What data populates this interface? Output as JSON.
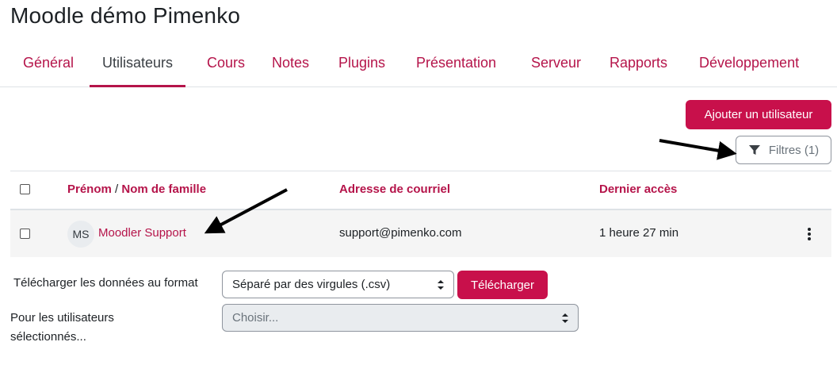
{
  "page": {
    "title": "Moodle démo Pimenko"
  },
  "tabs": [
    {
      "label": "Général",
      "active": false
    },
    {
      "label": "Utilisateurs",
      "active": true
    },
    {
      "label": "Cours",
      "active": false
    },
    {
      "label": "Notes",
      "active": false
    },
    {
      "label": "Plugins",
      "active": false
    },
    {
      "label": "Présentation",
      "active": false
    },
    {
      "label": "Serveur",
      "active": false
    },
    {
      "label": "Rapports",
      "active": false
    },
    {
      "label": "Développement",
      "active": false
    }
  ],
  "actions": {
    "add_user": "Ajouter un utilisateur",
    "filters": "Filtres (1)"
  },
  "table": {
    "columns": {
      "firstname": "Prénom",
      "separator": "/",
      "lastname": "Nom de famille",
      "email": "Adresse de courriel",
      "last_access": "Dernier accès"
    },
    "rows": [
      {
        "initials": "MS",
        "name": "Moodler Support",
        "email": "support@pimenko.com",
        "last_access": "1 heure 27 min"
      }
    ]
  },
  "download": {
    "label": "Télécharger les données au format",
    "format_selected": "Séparé par des virgules (.csv)",
    "button": "Télécharger"
  },
  "bulk": {
    "label": "Pour les utilisateurs sélectionnés...",
    "placeholder": "Choisir..."
  },
  "colors": {
    "accent": "#c8104b",
    "link": "#b5144a",
    "arrow": "#000000"
  },
  "icons": {
    "filter": "filter-icon",
    "row_menu": "kebab-menu-icon"
  }
}
